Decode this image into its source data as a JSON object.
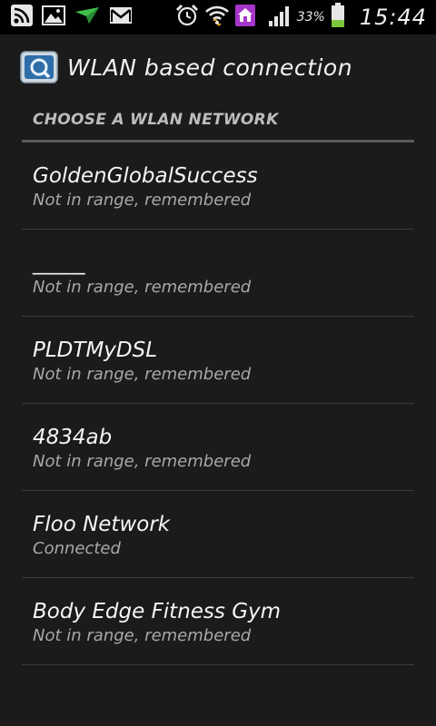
{
  "status_bar": {
    "icons_left": [
      "rss-icon",
      "gallery-icon",
      "send-icon",
      "gmail-icon"
    ],
    "icons_right": [
      "alarm-icon",
      "wifi-icon",
      "home-icon",
      "signal-icon"
    ],
    "battery_percent": "33%",
    "battery_level": 0.33,
    "time": "15:44"
  },
  "header": {
    "title": "WLAN based connection",
    "icon": "wlan-app-icon"
  },
  "section": {
    "title": "CHOOSE A WLAN NETWORK"
  },
  "networks": [
    {
      "name": "GoldenGlobalSuccess",
      "status": "Not in range, remembered"
    },
    {
      "name": "_____",
      "status": "Not in range, remembered"
    },
    {
      "name": "PLDTMyDSL",
      "status": "Not in range, remembered"
    },
    {
      "name": "4834ab",
      "status": "Not in range, remembered"
    },
    {
      "name": "Floo Network",
      "status": "Connected"
    },
    {
      "name": "Body Edge Fitness Gym",
      "status": "Not in range, remembered"
    }
  ],
  "colors": {
    "background": "#1b1b1b",
    "status_bar": "#000000",
    "battery_fill": "#7cc43a",
    "home_badge": "#a636c9"
  }
}
